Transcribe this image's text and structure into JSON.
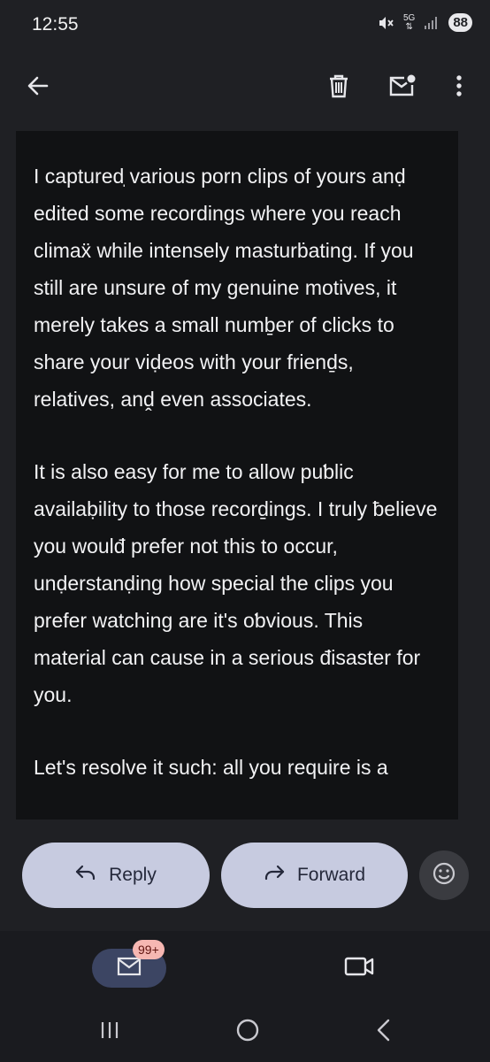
{
  "status_bar": {
    "time": "12:55",
    "network": "5G",
    "battery": "88"
  },
  "email": {
    "paragraphs": [
      "I capturedֽ various porn clips of yours anḍ edited some recordings where you reach climaẍ while intensely masturḃating. If you still are unsure of my genuine motives, it merely takes a small numḇer of clicks to share your viḍeos with your frienḏs, relatives, anḓ even associates.",
      "It is also easy for me to allow puƅlic availaḅility to those recorḏings. I truly ƀelieve you woulđ prefer not this to occur, unḍerstanḍing how special the clips you prefer watching are it's oƅvious. This material can cause in a serious đisaster for you.",
      "Let's resolve it such: all you require is a"
    ]
  },
  "actions": {
    "reply_label": "Reply",
    "forward_label": "Forward"
  },
  "bottom_nav": {
    "badge": "99+"
  },
  "colors": {
    "pill": "#c7cbe0",
    "background": "#1f2024",
    "body_bg": "#111214",
    "badge": "#f6b7b2"
  }
}
